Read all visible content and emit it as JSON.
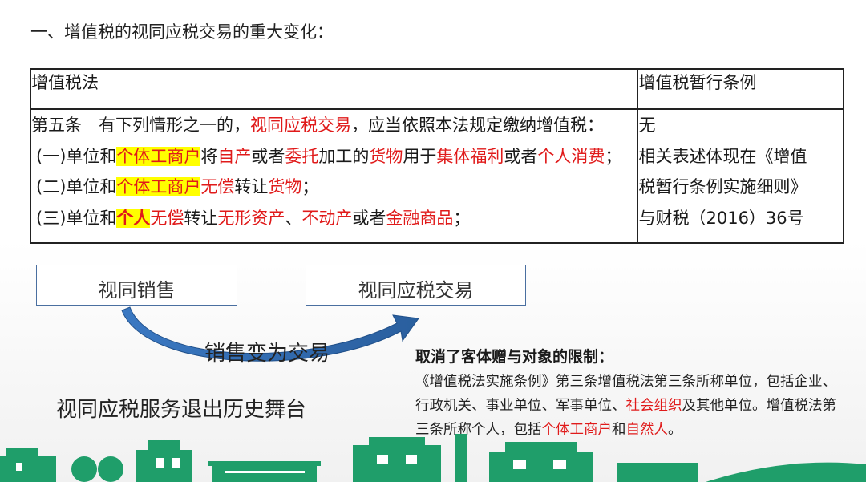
{
  "slide": {
    "title": "一、增值税的视同应税交易的重大变化："
  },
  "table": {
    "headers": [
      "增值税法",
      "增值税暂行条例"
    ],
    "law_lines": [
      [
        {
          "t": "第五条　有下列情形之一的，",
          "s": "n"
        },
        {
          "t": "视同应税交易",
          "s": "r"
        },
        {
          "t": "，应当依照本法规定缴纳增值税：",
          "s": "n"
        }
      ],
      [
        {
          "t": "(一)单位和",
          "s": "n"
        },
        {
          "t": "个体工商户",
          "s": "h"
        },
        {
          "t": "将",
          "s": "n"
        },
        {
          "t": "自产",
          "s": "r"
        },
        {
          "t": "或者",
          "s": "n"
        },
        {
          "t": "委托",
          "s": "r"
        },
        {
          "t": "加工的",
          "s": "n"
        },
        {
          "t": "货物",
          "s": "r"
        },
        {
          "t": "用于",
          "s": "n"
        },
        {
          "t": "集体福利",
          "s": "r"
        },
        {
          "t": "或者",
          "s": "n"
        },
        {
          "t": "个人消费",
          "s": "r"
        },
        {
          "t": "；",
          "s": "n"
        }
      ],
      [
        {
          "t": "(二)单位和",
          "s": "n"
        },
        {
          "t": "个体工商户",
          "s": "h"
        },
        {
          "t": "无偿",
          "s": "r"
        },
        {
          "t": "转让",
          "s": "n"
        },
        {
          "t": "货物",
          "s": "r"
        },
        {
          "t": "；",
          "s": "n"
        }
      ],
      [
        {
          "t": "(三)单位和",
          "s": "n"
        },
        {
          "t": "个人",
          "s": "hb"
        },
        {
          "t": "无偿",
          "s": "r"
        },
        {
          "t": "转让",
          "s": "n"
        },
        {
          "t": "无形资产",
          "s": "r"
        },
        {
          "t": "、",
          "s": "n"
        },
        {
          "t": "不动产",
          "s": "r"
        },
        {
          "t": "或者",
          "s": "n"
        },
        {
          "t": "金融商品",
          "s": "r"
        },
        {
          "t": "；",
          "s": "n"
        }
      ]
    ],
    "regulation_lines": [
      "无",
      "相关表述体现在《增值",
      "税暂行条例实施细则》",
      "与财税（2016）36号"
    ]
  },
  "diagram": {
    "left_box": "视同销售",
    "right_box": "视同应税交易",
    "transition_label": "销售变为交易",
    "exit_label": "视同应税服务退出历史舞台"
  },
  "note": {
    "title": "取消了客体赠与对象的限制：",
    "body": [
      {
        "t": "《增值税法实施条例》第三条增值税法第三条所称单位，包括企业、行政机关、事业单位、军事单位、",
        "s": "n"
      },
      {
        "t": "社会组织",
        "s": "r"
      },
      {
        "t": "及其他单位。增值税法第三条所称个人，包括",
        "s": "n"
      },
      {
        "t": "个体工商户",
        "s": "r"
      },
      {
        "t": "和",
        "s": "n"
      },
      {
        "t": "自然人",
        "s": "r"
      },
      {
        "t": "。",
        "s": "n"
      }
    ]
  },
  "colors": {
    "highlight": "#ffff00",
    "emphasis_red": "#e01a1a",
    "box_border": "#4a6fa0",
    "arrow_blue": "#2f6aa8",
    "skyline_green": "#1f9e6a"
  }
}
